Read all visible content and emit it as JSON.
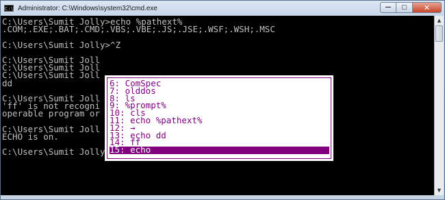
{
  "window": {
    "title": "Administrator: C:\\Windows\\system32\\cmd.exe",
    "icon": "cmd-icon",
    "icon_text": "C:\\",
    "buttons": {
      "minimize": "—",
      "maximize": "▢",
      "close": "✕"
    }
  },
  "console": {
    "lines": [
      "C:\\Users\\Sumit Jolly>echo %pathext%",
      ".COM;.EXE;.BAT;.CMD;.VBS;.VBE;.JS;.JSE;.WSF;.WSH;.MSC",
      "",
      "C:\\Users\\Sumit Jolly>^Z",
      "",
      "C:\\Users\\Sumit Joll",
      "C:\\Users\\Sumit Joll",
      "C:\\Users\\Sumit Joll",
      "dd",
      "",
      "C:\\Users\\Sumit Joll",
      "'ff' is not recogni",
      "operable program or",
      "",
      "C:\\Users\\Sumit Joll",
      "ECHO is on.",
      "",
      "C:\\Users\\Sumit Jolly>echo"
    ]
  },
  "history_popup": {
    "items": [
      "6: ComSpec",
      "7: olddos",
      "8: ls",
      "9: %prompt%",
      "10: cls",
      "11: echo %pathext%",
      "12: →",
      "13: echo dd",
      "14: ff",
      "15: echo"
    ],
    "selected_index": 9
  },
  "scrollbar": {
    "up": "▲",
    "down": "▼"
  }
}
